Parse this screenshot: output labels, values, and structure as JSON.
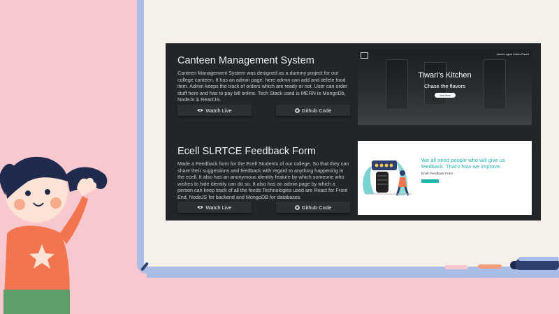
{
  "projects": [
    {
      "title": "Canteen Management System",
      "description": "Canteen Management System was designed as a dummy project for our college canteen. It has an admin page, here admin can add and delete food item. Admin keeps the track of orders which are ready or not. User can order stuff here and has to pay bill online. Tech Stack used is MERN ie MongoDb, NodeJs & ReactJS.",
      "watch_label": "Watch Live",
      "github_label": "Github Code"
    },
    {
      "title": "Ecell SLRTCE Feedback Form",
      "description": "Made a Feedback form for the Ecell Students of our college. So that they can share their suggestions and feedback with regard to anything happening in the ecell. It also has an anonymous identity feature by which someone who wishes to hide identity can do so. It also has an admin page by which a person can keep track of all the feeds Technologies used are React for Front End, NodeJS for backend and MongoDB for databases.",
      "watch_label": "Watch Live",
      "github_label": "Github Code"
    }
  ],
  "preview1": {
    "nav": "Admin   Logout   Orders Placed",
    "title": "Tiwari's Kitchen",
    "subtitle": "Chase the flavors",
    "button": "View More"
  },
  "preview2": {
    "heading": "We all need people who will give us feedback. That's how we improve.",
    "label": "Ecell Feedback Form"
  },
  "colors": {
    "panel": "#222629",
    "accent": "#21b5b0",
    "background": "#f9c8cf",
    "board": "#f5f1ea"
  },
  "icons": [
    "eye-icon",
    "github-icon"
  ]
}
